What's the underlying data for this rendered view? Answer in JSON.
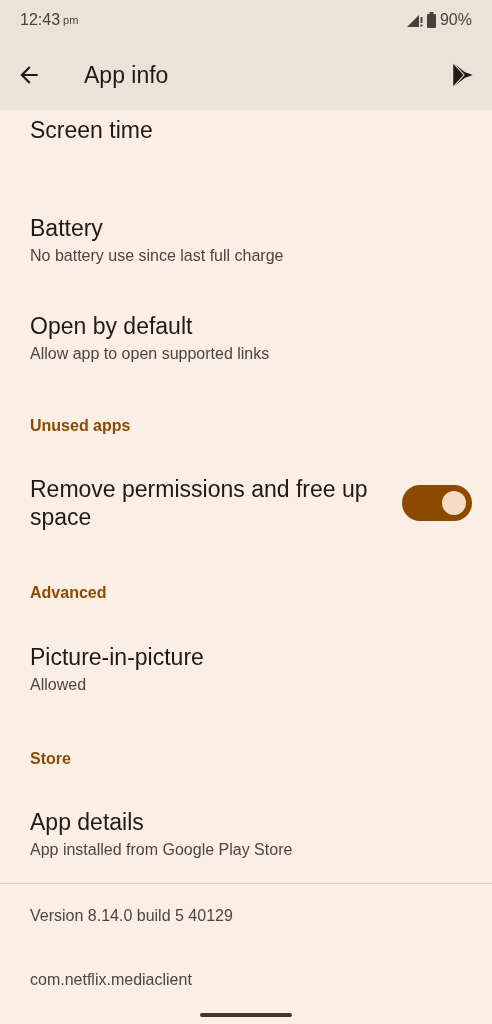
{
  "status_bar": {
    "time": "12:43",
    "ampm": "pm",
    "battery": "90%"
  },
  "app_bar": {
    "title": "App info"
  },
  "items": [
    {
      "kind": "cut",
      "title": "Screen time"
    },
    {
      "kind": "item",
      "title": "Battery",
      "subtitle": "No battery use since last full charge"
    },
    {
      "kind": "item",
      "title": "Open by default",
      "subtitle": "Allow app to open supported links"
    },
    {
      "kind": "header",
      "title": "Unused apps"
    },
    {
      "kind": "toggle",
      "title": "Remove permissions and free up space",
      "on": true
    },
    {
      "kind": "header",
      "title": "Advanced"
    },
    {
      "kind": "item",
      "title": "Picture-in-picture",
      "subtitle": "Allowed"
    },
    {
      "kind": "header",
      "title": "Store"
    },
    {
      "kind": "item",
      "title": "App details",
      "subtitle": "App installed from Google Play Store"
    },
    {
      "kind": "divider"
    },
    {
      "kind": "info",
      "title": "Version 8.14.0 build 5 40129"
    },
    {
      "kind": "info",
      "title": "com.netflix.mediaclient"
    }
  ]
}
